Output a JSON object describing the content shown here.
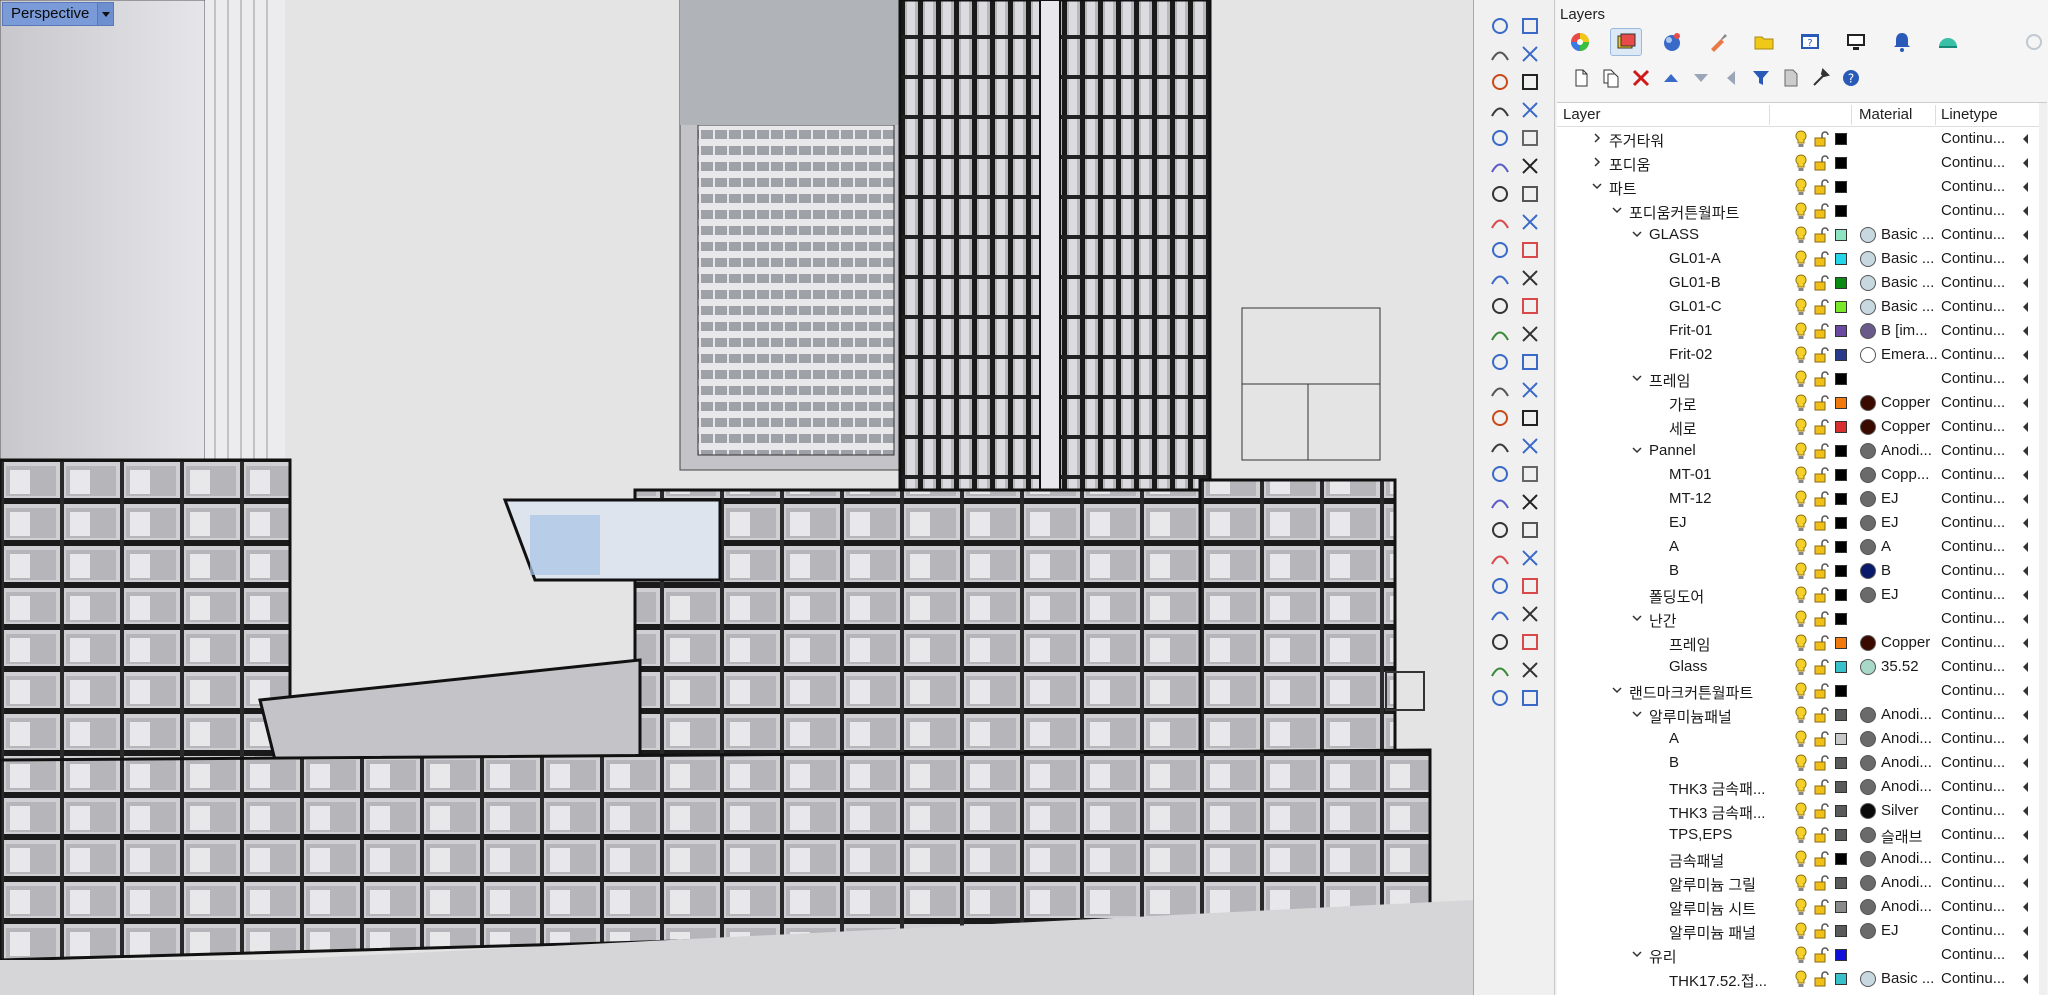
{
  "viewport": {
    "title": "Perspective"
  },
  "panel": {
    "title": "Layers"
  },
  "tabs": [
    {
      "name": "properties",
      "icon": "color-wheel-icon"
    },
    {
      "name": "layers",
      "icon": "layers-icon",
      "active": true
    },
    {
      "name": "materials",
      "icon": "sphere-icon"
    },
    {
      "name": "render",
      "icon": "brush-icon"
    },
    {
      "name": "files",
      "icon": "folder-icon"
    },
    {
      "name": "help",
      "icon": "help-window-icon"
    },
    {
      "name": "display",
      "icon": "monitor-icon"
    },
    {
      "name": "notifications",
      "icon": "bell-icon"
    },
    {
      "name": "environment",
      "icon": "dome-icon"
    }
  ],
  "columns": {
    "layer": "Layer",
    "material": "Material",
    "linetype": "Linetype"
  },
  "layers": [
    {
      "name": "주거타워",
      "depth": 0,
      "expanded": false,
      "hasChildren": true,
      "color": "#000000",
      "material": "",
      "matColor": null,
      "linetype": "Continu..."
    },
    {
      "name": "포디움",
      "depth": 0,
      "expanded": false,
      "hasChildren": true,
      "color": "#000000",
      "material": "",
      "matColor": null,
      "linetype": "Continu..."
    },
    {
      "name": "파트",
      "depth": 0,
      "expanded": true,
      "hasChildren": true,
      "color": "#000000",
      "material": "",
      "matColor": null,
      "linetype": "Continu..."
    },
    {
      "name": "포디움커튼월파트",
      "depth": 1,
      "expanded": true,
      "hasChildren": true,
      "color": "#000000",
      "material": "",
      "matColor": null,
      "linetype": "Continu..."
    },
    {
      "name": "GLASS",
      "depth": 2,
      "expanded": true,
      "hasChildren": true,
      "color": "#8fe3c0",
      "material": "Basic ...",
      "matColor": "#c8d8e0",
      "linetype": "Continu..."
    },
    {
      "name": "GL01-A",
      "depth": 3,
      "hasChildren": false,
      "color": "#26d5e8",
      "material": "Basic ...",
      "matColor": "#c8d8e0",
      "linetype": "Continu..."
    },
    {
      "name": "GL01-B",
      "depth": 3,
      "hasChildren": false,
      "color": "#0a8a14",
      "material": "Basic ...",
      "matColor": "#c8d8e0",
      "linetype": "Continu..."
    },
    {
      "name": "GL01-C",
      "depth": 3,
      "hasChildren": false,
      "color": "#7ae82a",
      "material": "Basic ...",
      "matColor": "#c8d8e0",
      "linetype": "Continu..."
    },
    {
      "name": "Frit-01",
      "depth": 3,
      "hasChildren": false,
      "color": "#6a4aa0",
      "material": "B [im...",
      "matColor": "#6a5a8a",
      "linetype": "Continu..."
    },
    {
      "name": "Frit-02",
      "depth": 3,
      "hasChildren": false,
      "color": "#2a3a8a",
      "material": "Emera...",
      "matColor": "#ffffff",
      "linetype": "Continu..."
    },
    {
      "name": "프레임",
      "depth": 2,
      "expanded": true,
      "hasChildren": true,
      "color": "#000000",
      "material": "",
      "matColor": null,
      "linetype": "Continu..."
    },
    {
      "name": "가로",
      "depth": 3,
      "hasChildren": false,
      "color": "#f07a10",
      "material": "Copper",
      "matColor": "#3a0a00",
      "linetype": "Continu..."
    },
    {
      "name": "세로",
      "depth": 3,
      "hasChildren": false,
      "color": "#d83030",
      "material": "Copper",
      "matColor": "#3a0a00",
      "linetype": "Continu..."
    },
    {
      "name": "Pannel",
      "depth": 2,
      "expanded": true,
      "hasChildren": true,
      "color": "#000000",
      "material": "Anodi...",
      "matColor": "#6a6a6a",
      "linetype": "Continu..."
    },
    {
      "name": "MT-01",
      "depth": 3,
      "hasChildren": false,
      "color": "#000000",
      "material": "Copp...",
      "matColor": "#6a6a6a",
      "linetype": "Continu..."
    },
    {
      "name": "MT-12",
      "depth": 3,
      "hasChildren": false,
      "color": "#000000",
      "material": "EJ",
      "matColor": "#6a6a6a",
      "linetype": "Continu..."
    },
    {
      "name": "EJ",
      "depth": 3,
      "hasChildren": false,
      "color": "#000000",
      "material": "EJ",
      "matColor": "#6a6a6a",
      "linetype": "Continu..."
    },
    {
      "name": "A",
      "depth": 3,
      "hasChildren": false,
      "color": "#000000",
      "material": "A",
      "matColor": "#6a6a6a",
      "linetype": "Continu..."
    },
    {
      "name": "B",
      "depth": 3,
      "hasChildren": false,
      "color": "#000000",
      "material": "B",
      "matColor": "#0a1a6a",
      "linetype": "Continu..."
    },
    {
      "name": "폴딩도어",
      "depth": 2,
      "hasChildren": false,
      "color": "#000000",
      "material": "EJ",
      "matColor": "#6a6a6a",
      "linetype": "Continu..."
    },
    {
      "name": "난간",
      "depth": 2,
      "expanded": true,
      "hasChildren": true,
      "color": "#000000",
      "material": "",
      "matColor": null,
      "linetype": "Continu..."
    },
    {
      "name": "프레임",
      "depth": 3,
      "hasChildren": false,
      "color": "#f07a10",
      "material": "Copper",
      "matColor": "#3a0a00",
      "linetype": "Continu..."
    },
    {
      "name": "Glass",
      "depth": 3,
      "hasChildren": false,
      "color": "#3ac0c8",
      "material": "35.52",
      "matColor": "#a8d8c8",
      "linetype": "Continu..."
    },
    {
      "name": "랜드마크커튼월파트",
      "depth": 1,
      "expanded": true,
      "hasChildren": true,
      "color": "#000000",
      "material": "",
      "matColor": null,
      "linetype": "Continu..."
    },
    {
      "name": "알루미늄패널",
      "depth": 2,
      "expanded": true,
      "hasChildren": true,
      "color": "#5a5a5a",
      "material": "Anodi...",
      "matColor": "#6a6a6a",
      "linetype": "Continu..."
    },
    {
      "name": "A",
      "depth": 3,
      "hasChildren": false,
      "color": "#c8c8c8",
      "material": "Anodi...",
      "matColor": "#6a6a6a",
      "linetype": "Continu..."
    },
    {
      "name": "B",
      "depth": 3,
      "hasChildren": false,
      "color": "#5a5a5a",
      "material": "Anodi...",
      "matColor": "#6a6a6a",
      "linetype": "Continu..."
    },
    {
      "name": "THK3 금속패...",
      "depth": 3,
      "hasChildren": false,
      "color": "#5a5a5a",
      "material": "Anodi...",
      "matColor": "#6a6a6a",
      "linetype": "Continu..."
    },
    {
      "name": "THK3 금속패...",
      "depth": 3,
      "hasChildren": false,
      "color": "#5a5a5a",
      "material": "Silver",
      "matColor": "#0a0a0a",
      "linetype": "Continu..."
    },
    {
      "name": "TPS,EPS",
      "depth": 3,
      "hasChildren": false,
      "color": "#5a5a5a",
      "material": "슬래브",
      "matColor": "#6a6a6a",
      "linetype": "Continu..."
    },
    {
      "name": "금속패널",
      "depth": 3,
      "hasChildren": false,
      "color": "#000000",
      "material": "Anodi...",
      "matColor": "#6a6a6a",
      "linetype": "Continu..."
    },
    {
      "name": "알루미늄 그릴",
      "depth": 3,
      "hasChildren": false,
      "color": "#5a5a5a",
      "material": "Anodi...",
      "matColor": "#6a6a6a",
      "linetype": "Continu..."
    },
    {
      "name": "알루미늄 시트",
      "depth": 3,
      "hasChildren": false,
      "color": "#8a8a8a",
      "material": "Anodi...",
      "matColor": "#6a6a6a",
      "linetype": "Continu..."
    },
    {
      "name": "알루미늄 패널",
      "depth": 3,
      "hasChildren": false,
      "color": "#5a5a5a",
      "material": "EJ",
      "matColor": "#6a6a6a",
      "linetype": "Continu..."
    },
    {
      "name": "유리",
      "depth": 2,
      "expanded": true,
      "hasChildren": true,
      "color": "#1010d8",
      "material": "",
      "matColor": null,
      "linetype": "Continu..."
    },
    {
      "name": "THK17.52.접...",
      "depth": 3,
      "hasChildren": false,
      "color": "#3ac0c8",
      "material": "Basic ...",
      "matColor": "#c8d8e0",
      "linetype": "Continu..."
    }
  ]
}
